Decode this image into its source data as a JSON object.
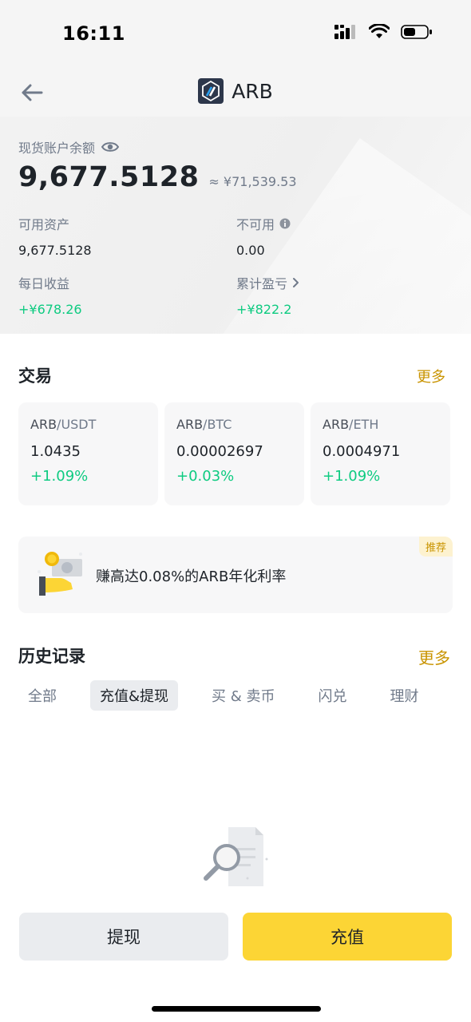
{
  "status_bar": {
    "time": "16:11"
  },
  "header": {
    "title": "ARB"
  },
  "balance": {
    "label": "现货账户余额",
    "amount": "9,677.5128",
    "fiat_equiv": "≈ ¥71,539.53",
    "available_label": "可用资产",
    "available_value": "9,677.5128",
    "unavailable_label": "不可用",
    "unavailable_value": "0.00",
    "daily_pnl_label": "每日收益",
    "daily_pnl_value": "+¥678.26",
    "cumulative_pnl_label": "累计盈亏",
    "cumulative_pnl_value": "+¥822.2"
  },
  "trade": {
    "title": "交易",
    "more": "更多",
    "pairs": [
      {
        "base": "ARB",
        "quote": "/USDT",
        "price": "1.0435",
        "change": "+1.09%"
      },
      {
        "base": "ARB",
        "quote": "/BTC",
        "price": "0.00002697",
        "change": "+0.03%"
      },
      {
        "base": "ARB",
        "quote": "/ETH",
        "price": "0.0004971",
        "change": "+1.09%"
      }
    ]
  },
  "promo": {
    "text": "赚高达0.08%的ARB年化利率",
    "badge": "推荐"
  },
  "history": {
    "title": "历史记录",
    "more": "更多",
    "tabs": [
      "全部",
      "充值&提现",
      "买 & 卖币",
      "闪兑",
      "理财"
    ],
    "active_tab": "充值&提现"
  },
  "actions": {
    "withdraw": "提现",
    "deposit": "充值"
  },
  "colors": {
    "accent": "#fcd535",
    "link": "#c99400",
    "positive": "#0ecb81"
  }
}
